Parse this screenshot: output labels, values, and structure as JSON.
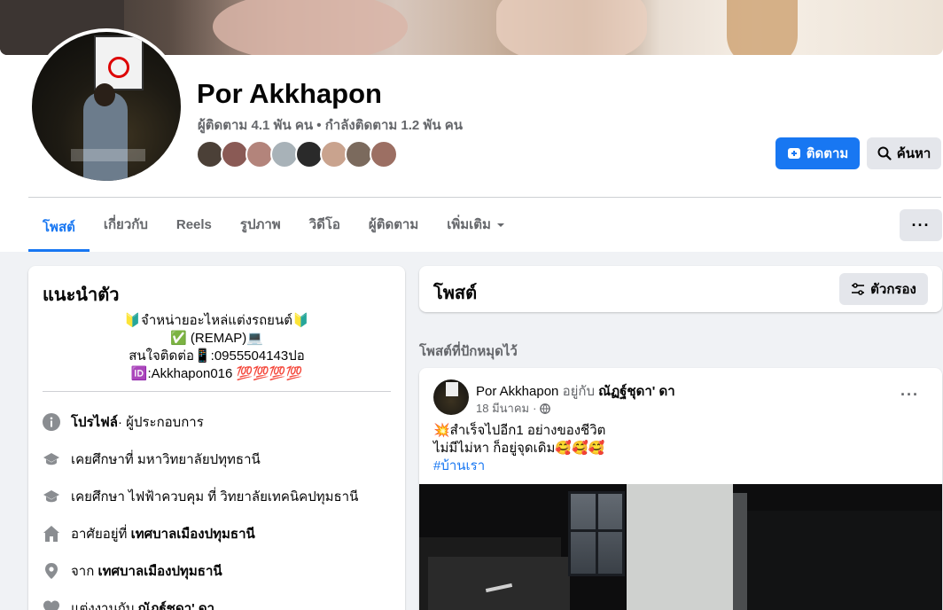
{
  "profile": {
    "name": "Por Akkhapon",
    "stats": "ผู้ติดตาม 4.1 พัน คน • กำลังติดตาม 1.2 พัน คน",
    "follow_label": "ติดตาม",
    "search_label": "ค้นหา"
  },
  "tabs": [
    {
      "label": "โพสต์",
      "active": true
    },
    {
      "label": "เกี่ยวกับ"
    },
    {
      "label": "Reels"
    },
    {
      "label": "รูปภาพ"
    },
    {
      "label": "วิดีโอ"
    },
    {
      "label": "ผู้ติดตาม"
    },
    {
      "label": "เพิ่มเติม"
    }
  ],
  "more_button": "···",
  "intro": {
    "title": "แนะนำตัว",
    "bio_lines": [
      "🔰จำหน่ายอะไหล่แต่งรถยนต์🔰",
      "✅ (REMAP)💻",
      "สนใจติดต่อ📱:0955504143ปอ",
      "🆔:Akkhapon016 💯💯💯💯"
    ],
    "items": [
      {
        "icon": "info-icon",
        "bold": "โปรไฟล์",
        "text": " · ผู้ประกอบการ"
      },
      {
        "icon": "graduation-cap-icon",
        "text": "เคยศึกษาที่ มหาวิทยาลัยปทุทธานี"
      },
      {
        "icon": "graduation-cap-icon",
        "text": "เคยศึกษา ไฟฟ้าควบคุม ที่ วิทยาลัยเทคนิคปทุมธานี"
      },
      {
        "icon": "home-icon",
        "text": "อาศัยอยู่ที่ ",
        "bold": "เทศบาลเมืองปทุมธานี"
      },
      {
        "icon": "location-pin-icon",
        "text": "จาก ",
        "bold": "เทศบาลเมืองปทุมธานี"
      },
      {
        "icon": "heart-icon",
        "text": "แต่งงานกับ ",
        "bold": "ณัฏฐ์ชุดา' ดา"
      }
    ]
  },
  "posts": {
    "title": "โพสต์",
    "filter_label": "ตัวกรอง",
    "pinned_label": "โพสต์ที่ปักหมุดไว้"
  },
  "post": {
    "author": "Por Akkhapon",
    "with_text": "อยู่กับ",
    "tagged": "ณัฏฐ์ชุดา' ดา",
    "date": "18 มีนาคม",
    "dots": "···",
    "line1": "💥สำเร็จไปอีก1 อย่างของชีวิต",
    "line2": "ไม่มีไม่หา ก็อยู่จุดเดิม🥰🥰🥰",
    "hashtag": "#บ้านเรา"
  },
  "colors": {
    "accent": "#1877f2",
    "background": "#f0f2f5",
    "muted_text": "#65676b",
    "button_gray": "#e4e6eb"
  }
}
